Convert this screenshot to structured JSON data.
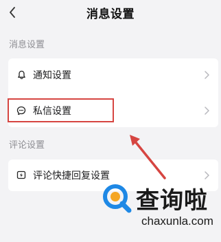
{
  "header": {
    "title": "消息设置",
    "back_icon": "chevron-left-icon"
  },
  "sections": [
    {
      "label": "消息设置",
      "items": [
        {
          "label": "通知设置",
          "icon": "bell-icon"
        },
        {
          "label": "私信设置",
          "icon": "chat-bubble-icon"
        }
      ]
    },
    {
      "label": "评论设置",
      "items": [
        {
          "label": "评论快捷回复设置",
          "icon": "lightning-comment-icon"
        }
      ]
    }
  ],
  "annotation": {
    "highlight_color": "#d64541",
    "highlighted_item": "私信设置"
  },
  "watermark": {
    "title": "查询啦",
    "url": "chaxunla.com",
    "accent_blue": "#1e88e5",
    "accent_orange": "#f5a623"
  }
}
